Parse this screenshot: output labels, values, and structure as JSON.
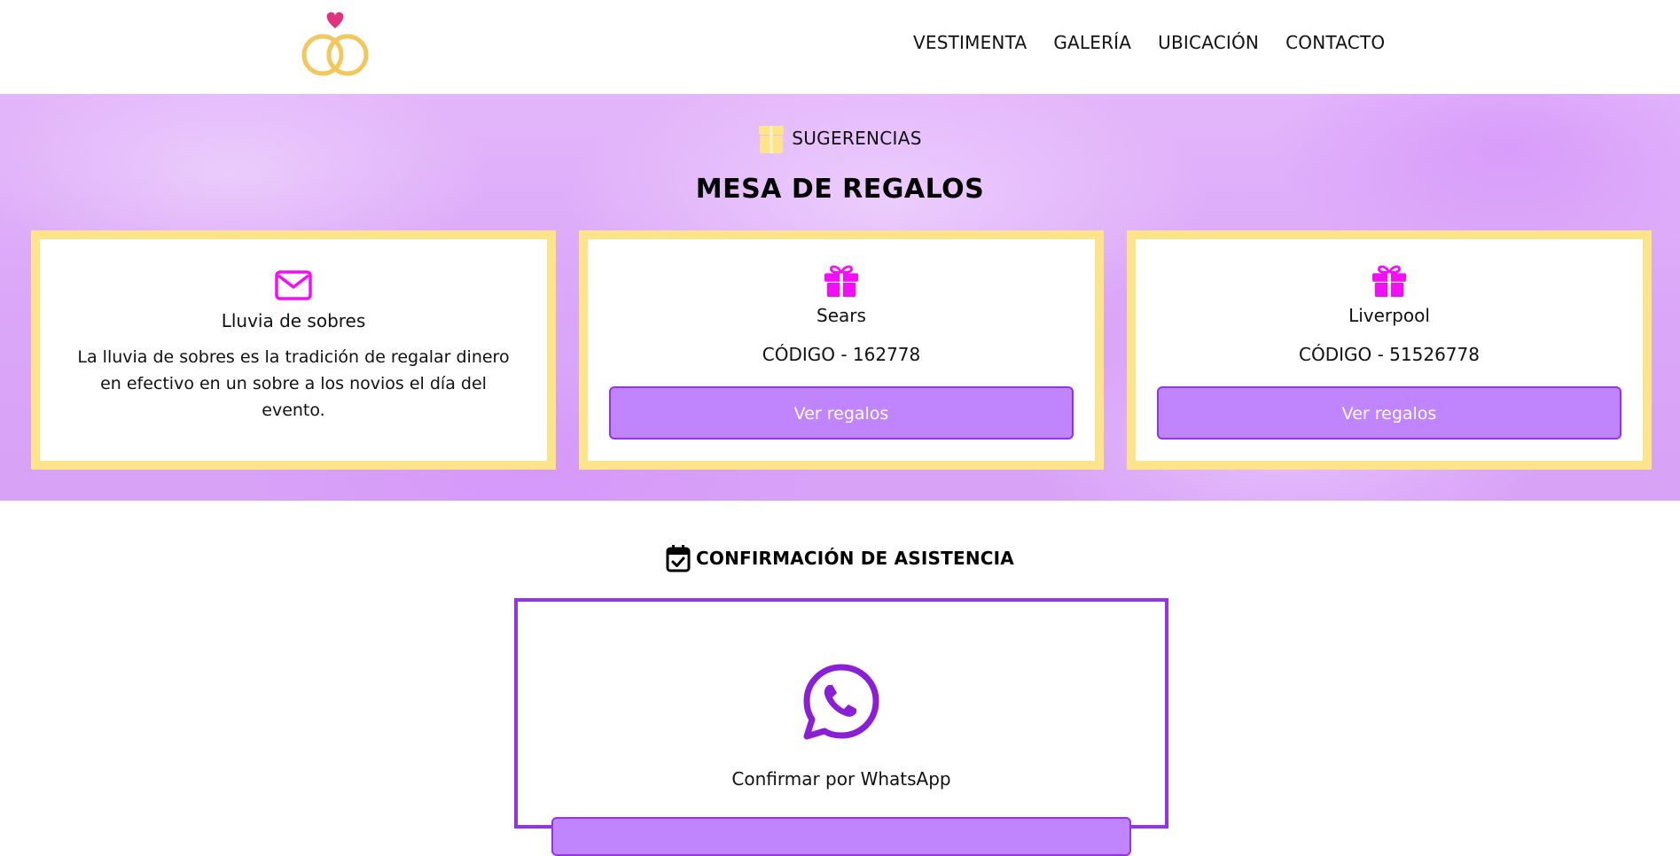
{
  "nav": {
    "items": [
      "VESTIMENTA",
      "GALERÍA",
      "UBICACIÓN",
      "CONTACTO"
    ]
  },
  "gifts": {
    "eyebrow": "SUGERENCIAS",
    "title": "MESA DE REGALOS",
    "cards": [
      {
        "icon": "envelope-icon",
        "title": "Lluvia de sobres",
        "text": "La lluvia de sobres es la tradición de regalar dinero en efectivo en un sobre a los novios el día del evento."
      },
      {
        "icon": "gift-icon",
        "title": "Sears",
        "code": "CÓDIGO - 162778",
        "button": "Ver regalos"
      },
      {
        "icon": "gift-icon",
        "title": "Liverpool",
        "code": "CÓDIGO - 51526778",
        "button": "Ver regalos"
      }
    ]
  },
  "rsvp": {
    "title": "CONFIRMACIÓN DE ASISTENCIA",
    "label": "Confirmar por WhatsApp"
  },
  "colors": {
    "accent_purple": "#9333ea",
    "button_fill": "#c084fc",
    "card_border": "#fde38a",
    "gift_icon": "#f20ff5",
    "ring_gold": "#f2c75c",
    "heart_pink": "#e0327d",
    "whatsapp_icon": "#8a1fd6"
  }
}
